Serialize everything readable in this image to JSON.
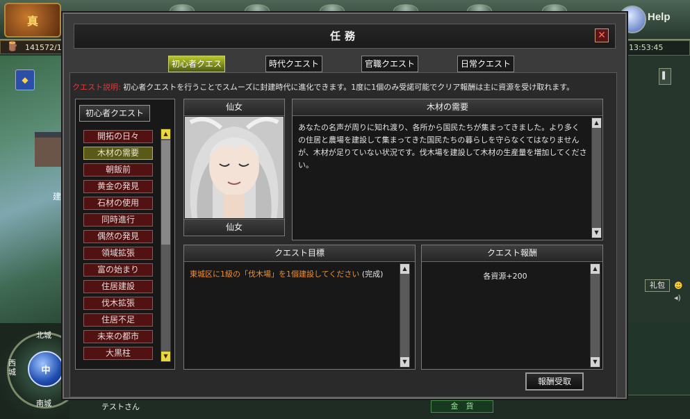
{
  "game": {
    "logo_text": "真",
    "help_label": "Help",
    "resource_value": "141572/1",
    "clock": "13:53:45",
    "map_label": "建",
    "gift_label": "礼包",
    "compass": {
      "center": "中",
      "north": "北城",
      "west": "西城",
      "south": "南城"
    },
    "player_name": "テストさん",
    "bottom_gold_label": "金　貨"
  },
  "modal": {
    "title": "任務",
    "close_symbol": "✕",
    "tabs": [
      {
        "label": "初心者クエスト",
        "active": true
      },
      {
        "label": "時代クエスト",
        "active": false
      },
      {
        "label": "官職クエスト",
        "active": false
      },
      {
        "label": "日常クエスト",
        "active": false
      }
    ],
    "description_label": "クエスト説明:",
    "description_text": "初心者クエストを行うことでスムーズに封建時代に進化できます。1度に1個のみ受諾可能でクリア報酬は主に資源を受け取れます。",
    "quest_list": {
      "header": "初心者クエスト",
      "items": [
        {
          "label": "開拓の日々",
          "selected": false
        },
        {
          "label": "木材の需要",
          "selected": true
        },
        {
          "label": "朝飯前",
          "selected": false
        },
        {
          "label": "黄金の発見",
          "selected": false
        },
        {
          "label": "石材の使用",
          "selected": false
        },
        {
          "label": "同時進行",
          "selected": false
        },
        {
          "label": "偶然の発見",
          "selected": false
        },
        {
          "label": "領域拡張",
          "selected": false
        },
        {
          "label": "富の始まり",
          "selected": false
        },
        {
          "label": "住居建設",
          "selected": false
        },
        {
          "label": "伐木拡張",
          "selected": false
        },
        {
          "label": "住居不足",
          "selected": false
        },
        {
          "label": "未来の都市",
          "selected": false
        },
        {
          "label": "大黒柱",
          "selected": false
        }
      ]
    },
    "npc": {
      "name_top": "仙女",
      "name_bottom": "仙女"
    },
    "story": {
      "title": "木材の需要",
      "text": "あなたの名声が周りに知れ渡り、各所から国民たちが集まってきました。より多くの住居と農場を建設して集まってきた国民たちの暮らしを守らなくてはなりませんが、木材が足りていない状況です。伐木場を建設して木材の生産量を増加してください。"
    },
    "goal": {
      "title": "クエスト目標",
      "text": "東城区に1級の「伐木場」を1個建設してください",
      "status": "(完成)"
    },
    "reward": {
      "title": "クエスト報酬",
      "text": "各資源+200"
    },
    "claim_button": "報酬受取"
  },
  "icons": {
    "scroll_up": "▲",
    "scroll_down": "▼",
    "resource_icon": "🪵",
    "shield_icon": "◆",
    "smile_icon": "☻",
    "volume_icon": "◂)"
  }
}
